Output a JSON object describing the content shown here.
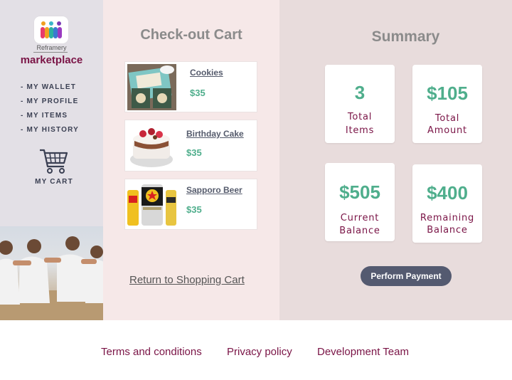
{
  "brand": {
    "sub": "Reframery",
    "title": "marketplace",
    "colors": {
      "accent": "#7a1446",
      "price": "#4fae8c",
      "nav": "#3a3f52",
      "button": "#545a70"
    }
  },
  "sidebar": {
    "items": [
      {
        "label": "- MY WALLET"
      },
      {
        "label": "- MY PROFILE"
      },
      {
        "label": "- MY ITEMS"
      },
      {
        "label": "- MY HISTORY"
      }
    ],
    "cart": {
      "label": "MY CART",
      "icon": "shopping-cart-icon"
    }
  },
  "cart": {
    "title": "Check-out Cart",
    "items": [
      {
        "name": "Cookies",
        "price": "$35"
      },
      {
        "name": "Birthday Cake",
        "price": "$35"
      },
      {
        "name": "Sapporo Beer",
        "price": "$35"
      }
    ],
    "return_label": "Return to Shopping Cart"
  },
  "summary": {
    "title": "Summary",
    "cards": [
      {
        "value": "3",
        "label_1": "Total",
        "label_2": "Items"
      },
      {
        "value": "$105",
        "label_1": "Total",
        "label_2": "Amount"
      },
      {
        "value": "$505",
        "label_1": "Current",
        "label_2": "Balance"
      },
      {
        "value": "$400",
        "label_1": "Remaining",
        "label_2": "Balance"
      }
    ],
    "pay_label": "Perform Payment"
  },
  "footer": {
    "links": [
      {
        "label": "Terms and conditions"
      },
      {
        "label": "Privacy policy"
      },
      {
        "label": "Development Team"
      }
    ]
  }
}
